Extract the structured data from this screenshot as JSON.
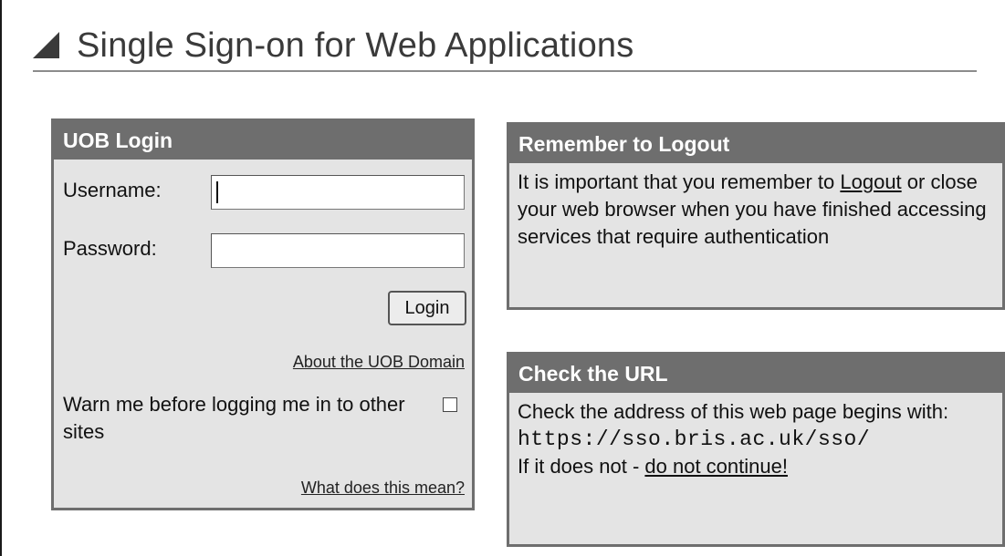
{
  "page": {
    "title": "Single Sign-on for Web Applications",
    "title_icon": "triangle-icon"
  },
  "login_panel": {
    "title": "UOB Login",
    "username_label": "Username:",
    "username_value": "",
    "password_label": "Password:",
    "password_value": "",
    "login_button": "Login",
    "about_link": "About the UOB Domain",
    "warn_text": "Warn me before logging me in to other sites",
    "warn_checked": false,
    "what_link": "What does this mean?"
  },
  "logout_panel": {
    "title": "Remember to Logout",
    "text_before": "It is important that you remember to ",
    "link": "Logout",
    "text_after": " or close your web browser when you have finished accessing services that require authentication"
  },
  "url_panel": {
    "title": "Check the URL",
    "text": "Check the address of this web page begins with:",
    "url": "https://sso.bris.ac.uk/sso/",
    "warning_prefix": "If it does not - ",
    "warning_link": "do not continue!"
  },
  "colors": {
    "panel_header": "#6e6e6e",
    "panel_body": "#e4e4e4",
    "heading_text": "#3a3a3a"
  }
}
